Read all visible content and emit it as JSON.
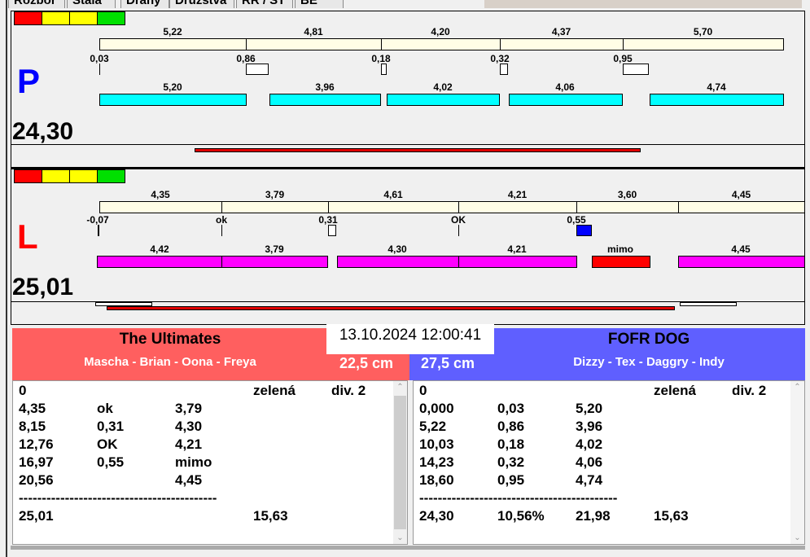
{
  "tabs": [
    "Rozbor",
    "Stala",
    "Dráhy",
    "Družstva",
    "RR / ST",
    "BE"
  ],
  "colors": {
    "red": "#ff0000",
    "yellow": "#ffff00",
    "green": "#00e000",
    "bar_light": "#fffde6",
    "cyan": "#00ffff",
    "magenta": "#ff00ff",
    "team_left": "#ff5f5f",
    "team_right": "#5f5fff",
    "marker_blue": "#0000ff"
  },
  "lane_p": {
    "letter": "P",
    "total": "24,30",
    "row1": [
      "5,22",
      "4,81",
      "4,20",
      "4,37",
      "5,70"
    ],
    "row2": [
      "0,03",
      "0,86",
      "0,18",
      "0,32",
      "0,95"
    ],
    "row3": [
      "5,20",
      "3,96",
      "4,02",
      "4,06",
      "4,74"
    ]
  },
  "lane_l": {
    "letter": "L",
    "total": "25,01",
    "row1": [
      "4,35",
      "3,79",
      "4,61",
      "4,21",
      "3,60",
      "4,45"
    ],
    "row2": [
      "-0,07",
      "ok",
      "0,31",
      "OK",
      "0,55"
    ],
    "row3": [
      "4,42",
      "3,79",
      "4,30",
      "4,21",
      "mimo",
      "4,45"
    ]
  },
  "datetime": "13.10.2024 12:00:41",
  "team_left": {
    "name": "The Ultimates",
    "players": "Mascha - Brian - Oona - Freya",
    "distance": "22,5 cm",
    "rows": [
      [
        "0",
        "",
        "",
        "zelená",
        "div. 2"
      ],
      [
        "4,35",
        "ok",
        "3,79",
        "",
        ""
      ],
      [
        "8,15",
        "0,31",
        "4,30",
        "",
        ""
      ],
      [
        "12,76",
        "OK",
        "4,21",
        "",
        ""
      ],
      [
        "16,97",
        "0,55",
        "mimo",
        "",
        ""
      ],
      [
        "20,56",
        "",
        "4,45",
        "",
        ""
      ],
      [
        "-------------------------------------------",
        "",
        "",
        "",
        ""
      ],
      [
        "25,01",
        "",
        "",
        "15,63",
        ""
      ]
    ]
  },
  "team_right": {
    "name": "FOFR DOG",
    "players": "Dizzy - Tex - Daggry - Indy",
    "distance": "27,5 cm",
    "rows": [
      [
        "0",
        "",
        "",
        "zelená",
        "div. 2"
      ],
      [
        "0,000",
        "0,03",
        "5,20",
        "",
        ""
      ],
      [
        "5,22",
        "0,86",
        "3,96",
        "",
        ""
      ],
      [
        "10,03",
        "0,18",
        "4,02",
        "",
        ""
      ],
      [
        "14,23",
        "0,32",
        "4,06",
        "",
        ""
      ],
      [
        "18,60",
        "0,95",
        "4,74",
        "",
        ""
      ],
      [
        "-------------------------------------------",
        "",
        "",
        "",
        ""
      ],
      [
        "24,30",
        "10,56%",
        "21,98",
        "15,63",
        ""
      ]
    ]
  }
}
